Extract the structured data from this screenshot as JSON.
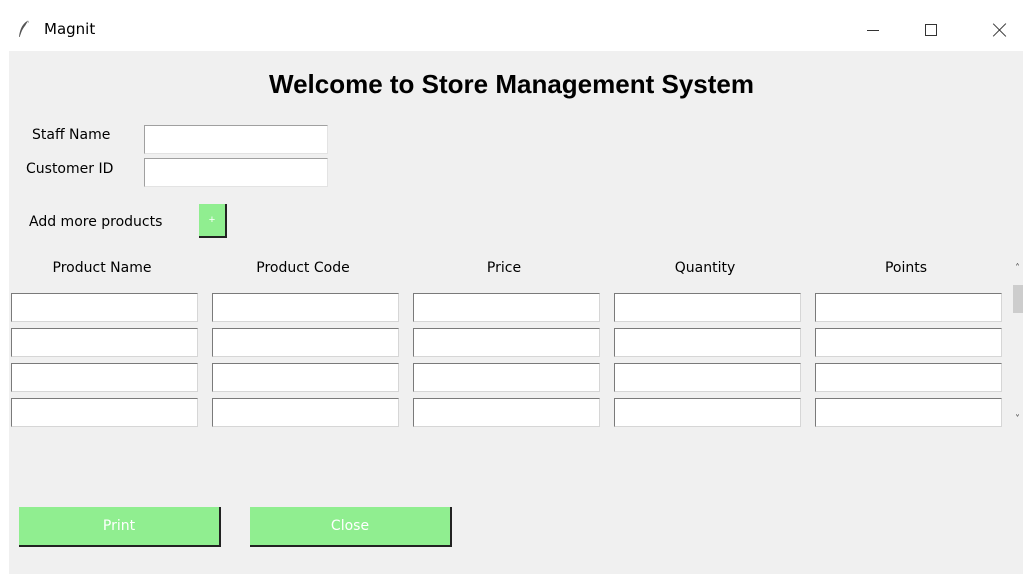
{
  "window": {
    "title": "Magnit",
    "icon": "feather-icon",
    "controls": [
      "minimize-icon",
      "maximize-icon",
      "close-icon"
    ]
  },
  "heading": "Welcome to Store Management System",
  "form": {
    "staff_name_label": "Staff Name",
    "staff_name_value": "",
    "customer_id_label": "Customer ID",
    "customer_id_value": ""
  },
  "add_products": {
    "label": "Add more products",
    "button_label": "+"
  },
  "table": {
    "columns": [
      "Product Name",
      "Product Code",
      "Price",
      "Quantity",
      "Points"
    ],
    "rows": [
      [
        "",
        "",
        "",
        "",
        ""
      ],
      [
        "",
        "",
        "",
        "",
        ""
      ],
      [
        "",
        "",
        "",
        "",
        ""
      ],
      [
        "",
        "",
        "",
        "",
        ""
      ]
    ]
  },
  "buttons": {
    "print": "Print",
    "close": "Close"
  },
  "colors": {
    "button_green": "#90ee90",
    "background": "#f0f0f0"
  }
}
